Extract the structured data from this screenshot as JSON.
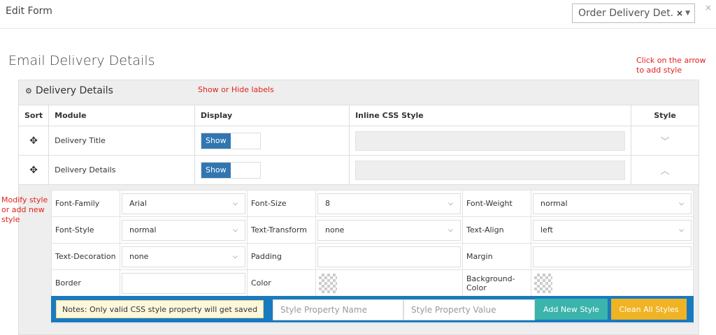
{
  "header": {
    "title": "Edit Form",
    "form_select": {
      "value": "Order Delivery Det...",
      "clear": "×",
      "caret": "▼"
    },
    "close": "×"
  },
  "section": {
    "title": "Email Delivery Details"
  },
  "annotations": {
    "arrow_hint": "Click on the arrow to add style",
    "labels_hint": "Show or Hide labels",
    "modify_hint": "Modify style or add new style",
    "arrow_glyph": "⇩"
  },
  "panel": {
    "title": "Delivery Details",
    "icon": "gears-icon",
    "columns": [
      "Sort",
      "Module",
      "Display",
      "Inline CSS Style",
      "Style"
    ],
    "rows": [
      {
        "module": "Delivery Title",
        "display": "Show",
        "style_toggle": "chevron-down-icon",
        "style_glyph": "﹀"
      },
      {
        "module": "Delivery Details",
        "display": "Show",
        "style_toggle": "chevron-up-icon",
        "style_glyph": "︿"
      }
    ]
  },
  "style_editor": {
    "font_family": {
      "label": "Font-Family",
      "value": "Arial"
    },
    "font_size": {
      "label": "Font-Size",
      "value": "8"
    },
    "font_weight": {
      "label": "Font-Weight",
      "value": "normal"
    },
    "font_style": {
      "label": "Font-Style",
      "value": "normal"
    },
    "text_transform": {
      "label": "Text-Transform",
      "value": "none"
    },
    "text_align": {
      "label": "Text-Align",
      "value": "left"
    },
    "text_decoration": {
      "label": "Text-Decoration",
      "value": "none"
    },
    "padding": {
      "label": "Padding",
      "value": ""
    },
    "margin": {
      "label": "Margin",
      "value": ""
    },
    "border": {
      "label": "Border",
      "value": ""
    },
    "color": {
      "label": "Color"
    },
    "background_color": {
      "label": "Background-Color"
    },
    "note": "Notes: Only valid CSS style property will get saved",
    "prop_name_placeholder": "Style Property Name",
    "prop_value_placeholder": "Style Property Value",
    "add_button": "Add New Style",
    "clean_button": "Clean All Styles"
  },
  "colors": {
    "show_toggle": "#3276b1",
    "annotation": "#e2211c",
    "add_bar": "#1a7ac0",
    "add_button": "#3bb4ab",
    "clean_button": "#f0b323"
  }
}
